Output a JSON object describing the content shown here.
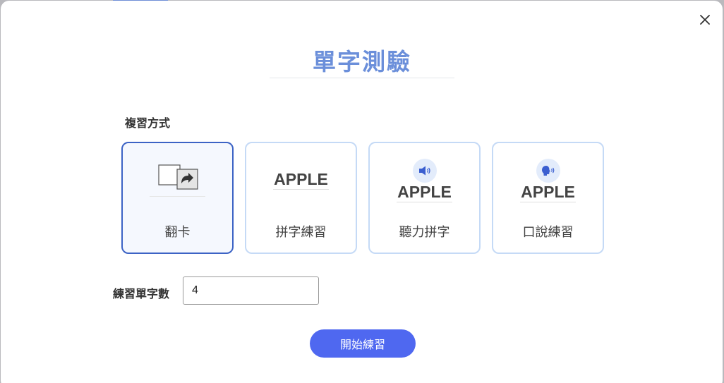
{
  "dialog": {
    "title": "單字測驗",
    "close_icon": "close-icon"
  },
  "review_mode": {
    "label": "複習方式",
    "selected": "翻卡",
    "options": [
      {
        "label": "翻卡",
        "icon": "flip-card-icon"
      },
      {
        "label": "拼字練習",
        "preview_word": "APPLE"
      },
      {
        "label": "聽力拼字",
        "preview_word": "APPLE",
        "icon": "speaker-icon"
      },
      {
        "label": "口說練習",
        "preview_word": "APPLE",
        "icon": "speaking-head-icon"
      }
    ]
  },
  "word_count": {
    "label": "練習單字數",
    "value": "4"
  },
  "start_button": {
    "label": "開始練習"
  },
  "colors": {
    "accent": "#4f68f0",
    "title": "#6b8fda",
    "selected_border": "#3c63c5",
    "card_border": "#c5daf6"
  }
}
